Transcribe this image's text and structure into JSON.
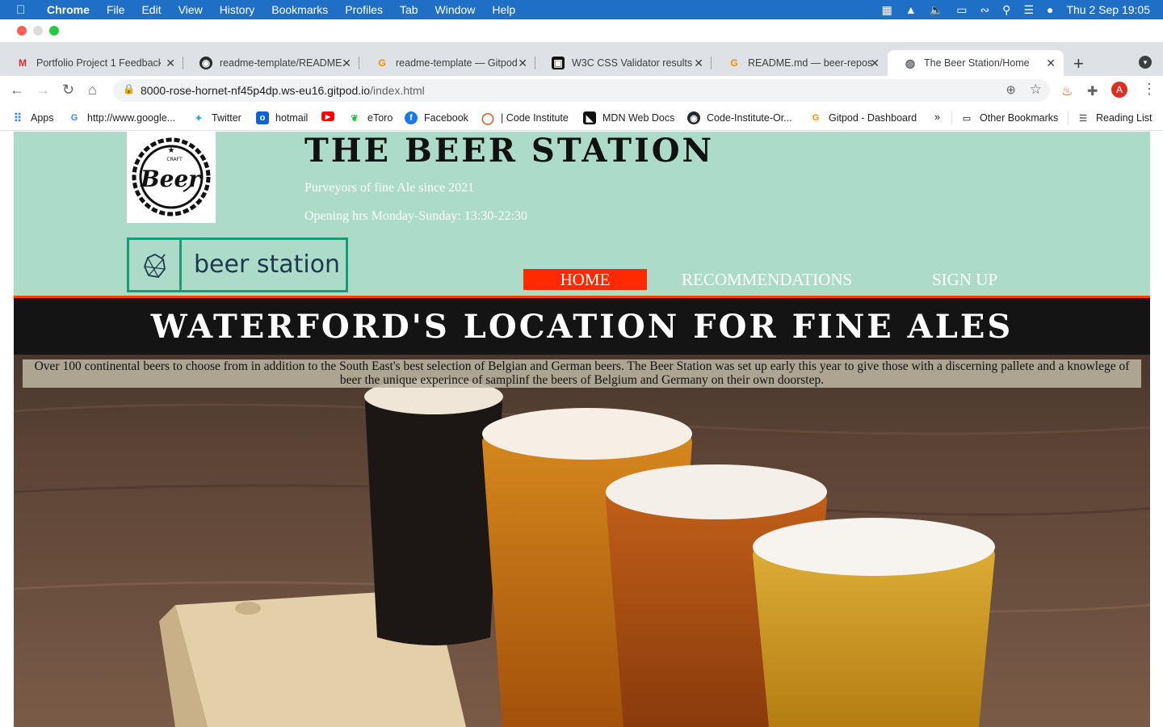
{
  "menubar": {
    "app": "Chrome",
    "items": [
      "File",
      "Edit",
      "View",
      "History",
      "Bookmarks",
      "Profiles",
      "Tab",
      "Window",
      "Help"
    ],
    "clock": "Thu 2 Sep  19:05"
  },
  "tabs": [
    {
      "label": "Portfolio Project 1 Feedback",
      "icon": "gmail-icon"
    },
    {
      "label": "readme-template/README.md",
      "icon": "github-icon"
    },
    {
      "label": "readme-template — Gitpod",
      "icon": "gitpod-icon"
    },
    {
      "label": "W3C CSS Validator results",
      "icon": "w3c-icon"
    },
    {
      "label": "README.md — beer-repository",
      "icon": "gitpod-icon"
    },
    {
      "label": "The Beer Station/Home",
      "icon": "globe-icon",
      "active": true
    }
  ],
  "address": {
    "host": "8000-rose-hornet-nf45p4dp.ws-eu16.gitpod.io",
    "path": "/index.html"
  },
  "bookmarks": [
    {
      "label": "Apps",
      "icon": "apps-grid-icon"
    },
    {
      "label": "http://www.google...",
      "icon": "google-icon"
    },
    {
      "label": "Twitter",
      "icon": "twitter-icon"
    },
    {
      "label": "hotmail",
      "icon": "outlook-icon"
    },
    {
      "label": "",
      "icon": "youtube-icon"
    },
    {
      "label": "eToro",
      "icon": "etoro-icon"
    },
    {
      "label": "Facebook",
      "icon": "facebook-icon"
    },
    {
      "label": "| Code Institute",
      "icon": "code-institute-icon"
    },
    {
      "label": "MDN Web Docs",
      "icon": "mdn-icon"
    },
    {
      "label": "Code-Institute-Or...",
      "icon": "github-icon"
    },
    {
      "label": "Gitpod - Dashboard",
      "icon": "gitpod-icon"
    }
  ],
  "bookmarks_right": {
    "more": "»",
    "other": "Other Bookmarks",
    "reading": "Reading List"
  },
  "page": {
    "title": "THE BEER STATION",
    "tagline": "Purveyors of fine Ale since 2021",
    "hours": "Opening hrs Monday-Sunday: 13:30-22:30",
    "brand": "beer station",
    "logo_text": "Beer",
    "logo_small": "CRAFT",
    "nav": [
      {
        "label": "HOME",
        "active": true
      },
      {
        "label": "RECOMMENDATIONS"
      },
      {
        "label": "SIGN UP"
      }
    ],
    "hero_title": "WATERFORD'S LOCATION FOR FINE ALES",
    "hero_blurb": "Over 100 continental beers to choose from in addition to the South East's best selection of Belgian and German beers. The Beer Station was set up early this year to give those with a discerning pallete and a knowlege of beer the unique experince of samplinf the beers of Belgium and Germany on their own doorstep."
  },
  "colors": {
    "header_bg": "#acdbc9",
    "nav_active": "#ff2a00",
    "rule": "#ff3c10",
    "brand_border": "#169c79"
  }
}
